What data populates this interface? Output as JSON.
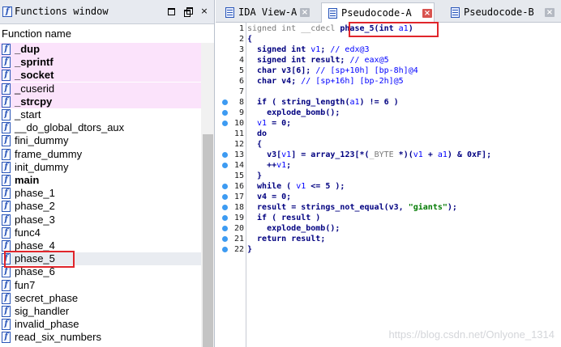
{
  "functions_window": {
    "title": "Functions window",
    "column_header": "Function name",
    "icon": "function-icon",
    "items": [
      {
        "name": "_dup",
        "lib": true,
        "bold": true
      },
      {
        "name": "_sprintf",
        "lib": true,
        "bold": true
      },
      {
        "name": "_socket",
        "lib": true,
        "bold": true
      },
      {
        "name": "_cuserid",
        "lib": true,
        "bold": false
      },
      {
        "name": "_strcpy",
        "lib": true,
        "bold": true
      },
      {
        "name": "_start",
        "lib": false,
        "bold": false
      },
      {
        "name": "__do_global_dtors_aux",
        "lib": false,
        "bold": false
      },
      {
        "name": "fini_dummy",
        "lib": false,
        "bold": false
      },
      {
        "name": "frame_dummy",
        "lib": false,
        "bold": false
      },
      {
        "name": "init_dummy",
        "lib": false,
        "bold": false
      },
      {
        "name": "main",
        "lib": false,
        "bold": true
      },
      {
        "name": "phase_1",
        "lib": false,
        "bold": false
      },
      {
        "name": "phase_2",
        "lib": false,
        "bold": false
      },
      {
        "name": "phase_3",
        "lib": false,
        "bold": false
      },
      {
        "name": "func4",
        "lib": false,
        "bold": false
      },
      {
        "name": "phase_4",
        "lib": false,
        "bold": false
      },
      {
        "name": "phase_5",
        "lib": false,
        "bold": false,
        "selected": true
      },
      {
        "name": "phase_6",
        "lib": false,
        "bold": false
      },
      {
        "name": "fun7",
        "lib": false,
        "bold": false
      },
      {
        "name": "secret_phase",
        "lib": false,
        "bold": false
      },
      {
        "name": "sig_handler",
        "lib": false,
        "bold": false
      },
      {
        "name": "invalid_phase",
        "lib": false,
        "bold": false
      },
      {
        "name": "read_six_numbers",
        "lib": false,
        "bold": false
      }
    ]
  },
  "tabs": [
    {
      "label": "IDA View-A",
      "close": "×",
      "active": false
    },
    {
      "label": "Pseudocode-A",
      "close": "×",
      "active": true
    },
    {
      "label": "Pseudocode-B",
      "close": "×",
      "active": false
    }
  ],
  "pseudocode": [
    {
      "n": "1",
      "dot": false,
      "segs": [
        [
          "g",
          "signed int __cdecl "
        ],
        [
          "n",
          "phase_5"
        ],
        [
          "p",
          "("
        ],
        [
          "k",
          "int"
        ],
        [
          "v",
          " a1"
        ],
        [
          "p",
          ")"
        ]
      ]
    },
    {
      "n": "2",
      "dot": false,
      "segs": [
        [
          "p",
          "{"
        ]
      ]
    },
    {
      "n": "3",
      "dot": false,
      "segs": [
        [
          "k",
          "  signed int "
        ],
        [
          "v",
          "v1"
        ],
        [
          "p",
          "; "
        ],
        [
          "c",
          "// edx@3"
        ]
      ]
    },
    {
      "n": "4",
      "dot": false,
      "segs": [
        [
          "k",
          "  signed int "
        ],
        [
          "n",
          "result"
        ],
        [
          "p",
          "; "
        ],
        [
          "c",
          "// eax@5"
        ]
      ]
    },
    {
      "n": "5",
      "dot": false,
      "segs": [
        [
          "k",
          "  char "
        ],
        [
          "n",
          "v3"
        ],
        [
          "p",
          "[6]; "
        ],
        [
          "c",
          "// [sp+10h] [bp-8h]@4"
        ]
      ]
    },
    {
      "n": "6",
      "dot": false,
      "segs": [
        [
          "k",
          "  char "
        ],
        [
          "n",
          "v4"
        ],
        [
          "p",
          "; "
        ],
        [
          "c",
          "// [sp+16h] [bp-2h]@5"
        ]
      ]
    },
    {
      "n": "7",
      "dot": false,
      "segs": []
    },
    {
      "n": "8",
      "dot": true,
      "segs": [
        [
          "k",
          "  if "
        ],
        [
          "p",
          "( "
        ],
        [
          "n",
          "string_length"
        ],
        [
          "p",
          "("
        ],
        [
          "v",
          "a1"
        ],
        [
          "p",
          ") != 6 )"
        ]
      ]
    },
    {
      "n": "9",
      "dot": true,
      "segs": [
        [
          "n",
          "    explode_bomb"
        ],
        [
          "p",
          "();"
        ]
      ]
    },
    {
      "n": "10",
      "dot": true,
      "segs": [
        [
          "v",
          "  v1"
        ],
        [
          "p",
          " = 0;"
        ]
      ]
    },
    {
      "n": "11",
      "dot": false,
      "segs": [
        [
          "k",
          "  do"
        ]
      ]
    },
    {
      "n": "12",
      "dot": false,
      "segs": [
        [
          "p",
          "  {"
        ]
      ]
    },
    {
      "n": "13",
      "dot": true,
      "segs": [
        [
          "n",
          "    v3"
        ],
        [
          "p",
          "["
        ],
        [
          "v",
          "v1"
        ],
        [
          "p",
          "] = "
        ],
        [
          "n",
          "array_123"
        ],
        [
          "p",
          "[*("
        ],
        [
          "g",
          "_BYTE"
        ],
        [
          "p",
          " *)("
        ],
        [
          "v",
          "v1"
        ],
        [
          "p",
          " + "
        ],
        [
          "v",
          "a1"
        ],
        [
          "p",
          ") & 0xF];"
        ]
      ]
    },
    {
      "n": "14",
      "dot": true,
      "segs": [
        [
          "p",
          "    ++"
        ],
        [
          "v",
          "v1"
        ],
        [
          "p",
          ";"
        ]
      ]
    },
    {
      "n": "15",
      "dot": false,
      "segs": [
        [
          "p",
          "  }"
        ]
      ]
    },
    {
      "n": "16",
      "dot": true,
      "segs": [
        [
          "k",
          "  while "
        ],
        [
          "p",
          "( "
        ],
        [
          "v",
          "v1"
        ],
        [
          "p",
          " <= 5 );"
        ]
      ]
    },
    {
      "n": "17",
      "dot": true,
      "segs": [
        [
          "n",
          "  v4"
        ],
        [
          "p",
          " = 0;"
        ]
      ]
    },
    {
      "n": "18",
      "dot": true,
      "segs": [
        [
          "n",
          "  result"
        ],
        [
          "p",
          " = "
        ],
        [
          "n",
          "strings_not_equal"
        ],
        [
          "p",
          "("
        ],
        [
          "n",
          "v3"
        ],
        [
          "p",
          ", "
        ],
        [
          "s",
          "\"giants\""
        ],
        [
          "p",
          ");"
        ]
      ]
    },
    {
      "n": "19",
      "dot": true,
      "segs": [
        [
          "k",
          "  if "
        ],
        [
          "p",
          "( "
        ],
        [
          "n",
          "result"
        ],
        [
          "p",
          " )"
        ]
      ]
    },
    {
      "n": "20",
      "dot": true,
      "segs": [
        [
          "n",
          "    explode_bomb"
        ],
        [
          "p",
          "();"
        ]
      ]
    },
    {
      "n": "21",
      "dot": true,
      "segs": [
        [
          "k",
          "  return "
        ],
        [
          "n",
          "result"
        ],
        [
          "p",
          ";"
        ]
      ]
    },
    {
      "n": "22",
      "dot": true,
      "segs": [
        [
          "p",
          "}"
        ]
      ]
    }
  ],
  "watermark": "https://blog.csdn.net/Onlyone_1314",
  "colors": {
    "highlight_box": "#e0252b",
    "lib_function_bg": "#fbe3fb",
    "breakpoint_dot": "#3d9bf2"
  }
}
